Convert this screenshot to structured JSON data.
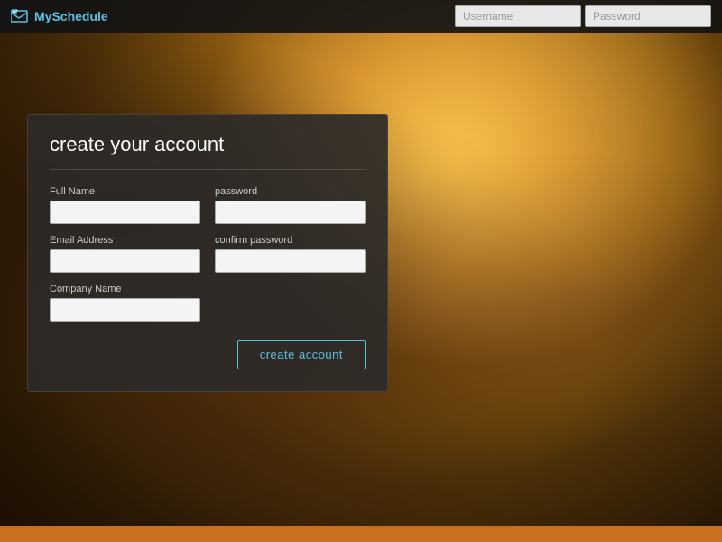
{
  "navbar": {
    "logo_brand": "My",
    "logo_product": "Schedule",
    "username_placeholder": "Username",
    "password_placeholder": "Password"
  },
  "card": {
    "title": "create your account",
    "fields": {
      "full_name_label": "Full Name",
      "password_label": "password",
      "email_label": "Email Address",
      "confirm_password_label": "confirm password",
      "company_label": "Company Name"
    },
    "submit_button": "create account"
  }
}
